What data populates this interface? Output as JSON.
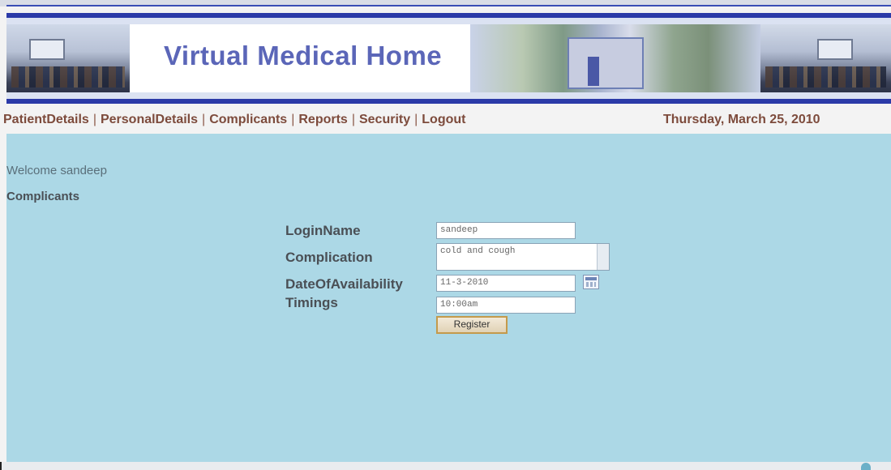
{
  "header": {
    "title": "Virtual Medical Home"
  },
  "nav": {
    "items": [
      "PatientDetails",
      "PersonalDetails",
      "Complicants",
      "Reports",
      "Security",
      "Logout"
    ],
    "separator": "|",
    "date": "Thursday, March 25, 2010"
  },
  "main": {
    "welcome": "Welcome sandeep",
    "section_title": "Complicants",
    "form": {
      "login_name_label": "LoginName",
      "login_name_value": "sandeep",
      "complication_label": "Complication",
      "complication_value": "cold and cough",
      "date_label": "DateOfAvailability",
      "date_value": "11-3-2010",
      "timings_label": "Timings",
      "timings_value": "10:00am",
      "register_label": "Register"
    }
  },
  "icons": {
    "calendar": "calendar-icon",
    "status": "globe-icon"
  }
}
